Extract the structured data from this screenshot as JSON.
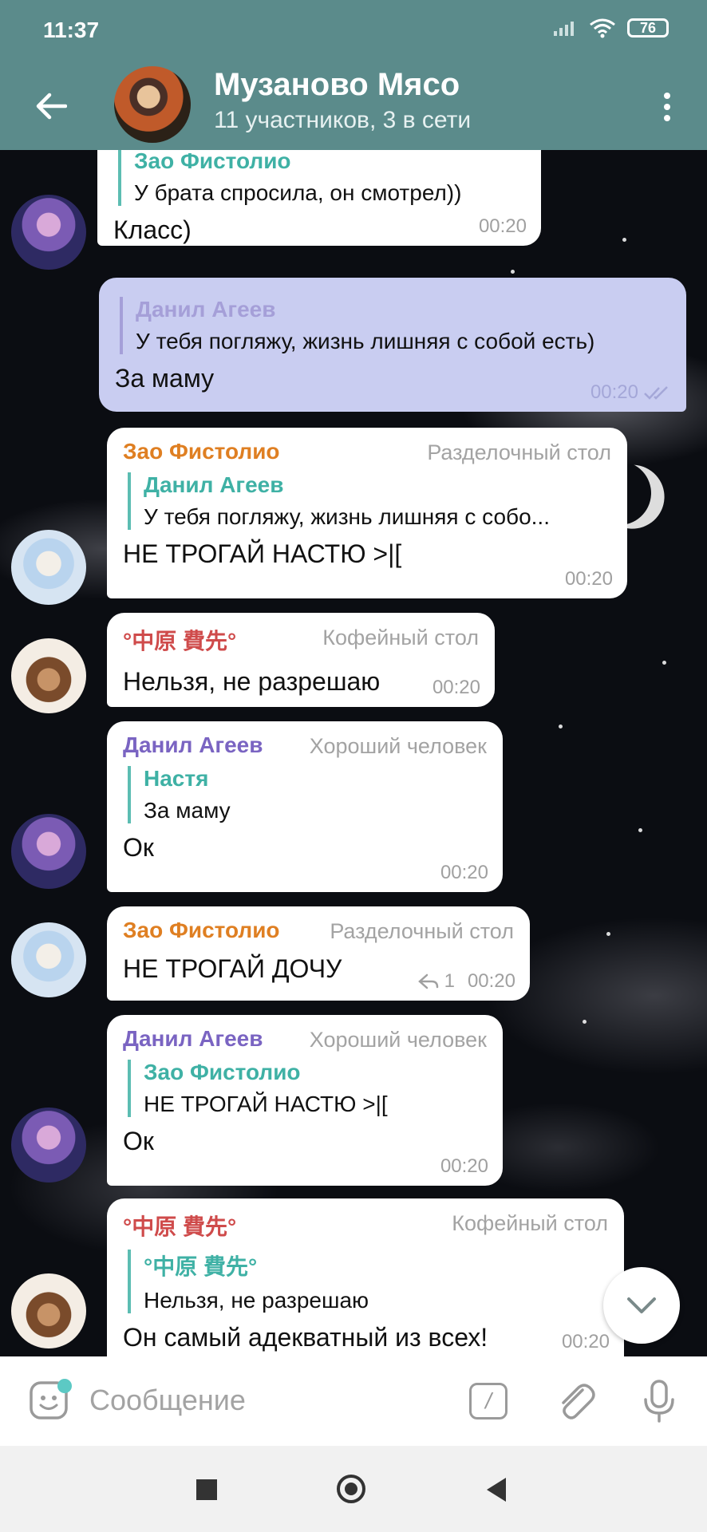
{
  "status_bar": {
    "time": "11:37",
    "battery": "76"
  },
  "header": {
    "title": "Музаново Мясо",
    "subtitle": "11 участников, 3 в сети"
  },
  "messages": [
    {
      "reply_name": "Зао Фистолио",
      "reply_text": "У брата спросила, он смотрел))",
      "text": "Класс)",
      "time": "00:20"
    },
    {
      "reply_name": "Данил Агеев",
      "reply_text": "У тебя погляжу, жизнь лишняя с собой есть)",
      "text": "За маму",
      "time": "00:20"
    },
    {
      "sender": "Зао Фистолио",
      "role": "Разделочный стол",
      "reply_name": "Данил Агеев",
      "reply_text": "У тебя погляжу, жизнь лишняя с собо...",
      "text": "НЕ ТРОГАЙ НАСТЮ >|[",
      "time": "00:20"
    },
    {
      "sender": "°中原 費先°",
      "role": "Кофейный стол",
      "text": "Нельзя, не разрешаю",
      "time": "00:20"
    },
    {
      "sender": "Данил Агеев",
      "role": "Хороший человек",
      "reply_name": "Настя",
      "reply_text": "За маму",
      "text": "Ок",
      "time": "00:20"
    },
    {
      "sender": "Зао Фистолио",
      "role": "Разделочный стол",
      "text": "НЕ ТРОГАЙ ДОЧУ",
      "reply_count": "1",
      "time": "00:20"
    },
    {
      "sender": "Данил Агеев",
      "role": "Хороший человек",
      "reply_name": "Зао Фистолио",
      "reply_text": "НЕ ТРОГАЙ НАСТЮ >|[",
      "text": "Ок",
      "time": "00:20"
    },
    {
      "sender": "°中原 費先°",
      "role": "Кофейный стол",
      "reply_name": "°中原 費先°",
      "reply_text": "Нельзя, не разрешаю",
      "text": "Он самый адекватный из всех!",
      "time": "00:20"
    }
  ],
  "input": {
    "placeholder": "Сообщение",
    "command_symbol": "/"
  },
  "colors": {
    "header": "#5b8b8b",
    "outgoing_bubble": "#c9cdf1",
    "incoming_bubble": "#ffffff",
    "reply_accent": "#3fb1a5"
  },
  "icons": [
    "back-arrow-icon",
    "more-vert-icon",
    "wifi-icon",
    "signal-icon",
    "battery-icon",
    "double-check-icon",
    "reply-arrow-icon",
    "chevron-down-icon",
    "sticker-icon",
    "command-icon",
    "attach-icon",
    "mic-icon"
  ]
}
